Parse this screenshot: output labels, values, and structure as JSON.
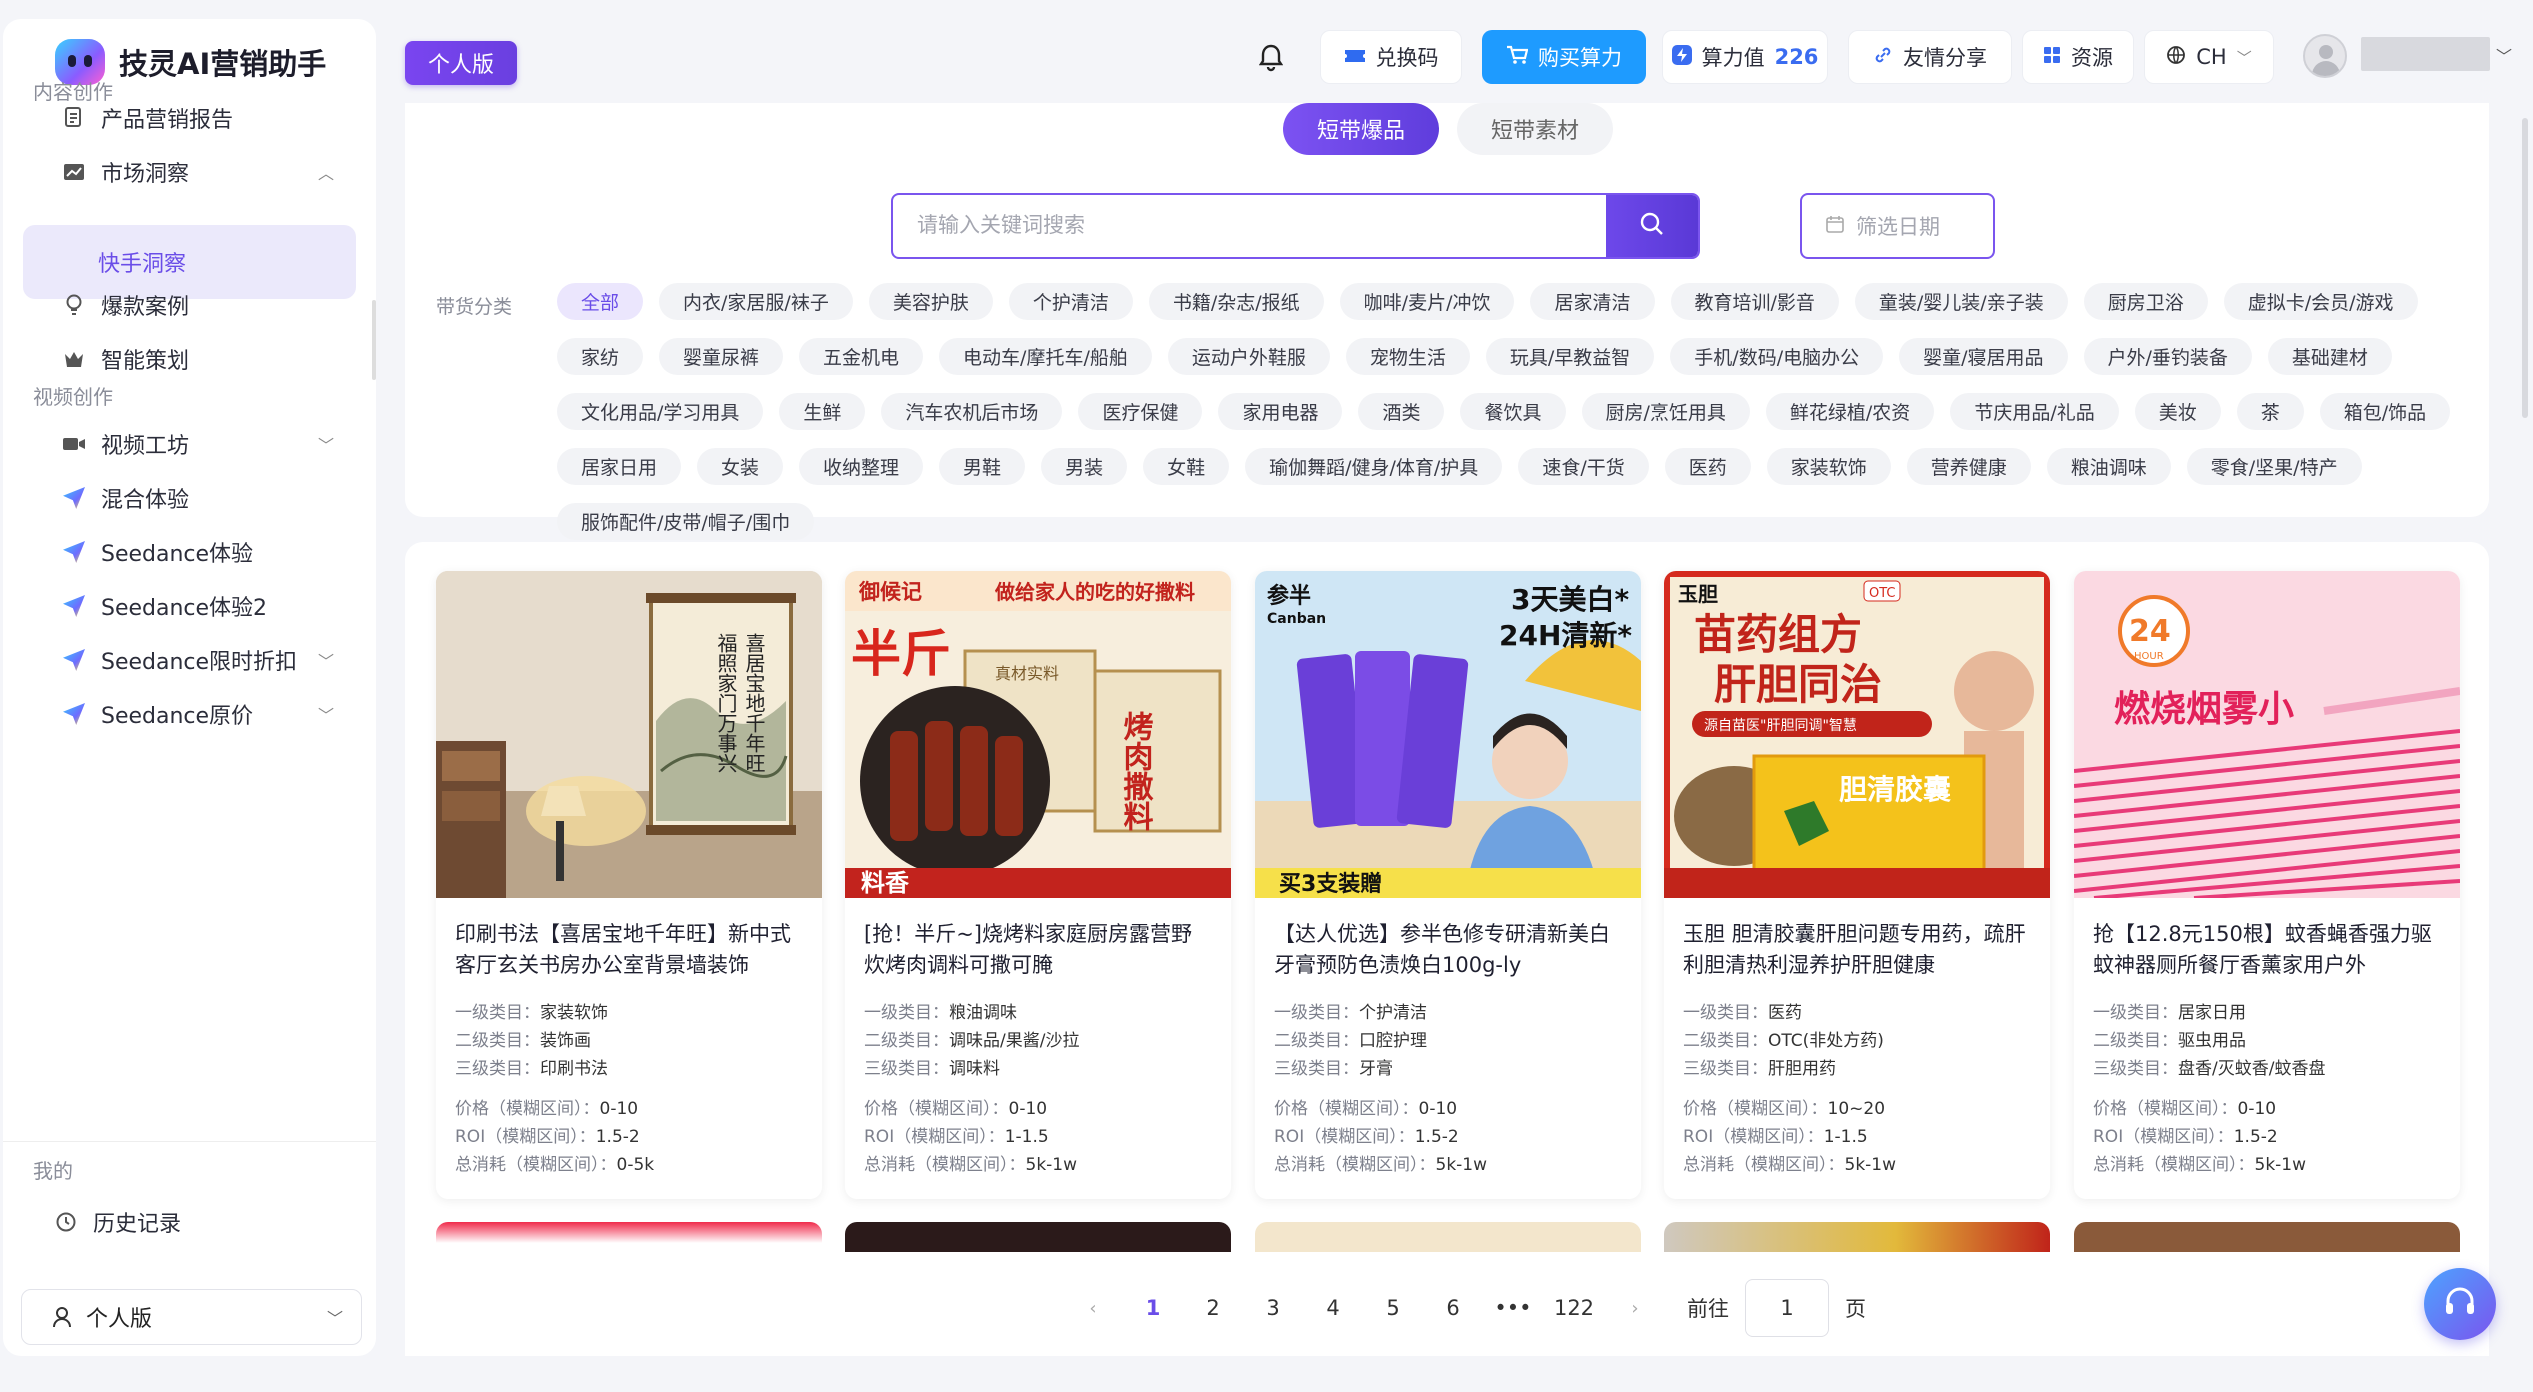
{
  "app": {
    "name": "技灵AI营销助手",
    "edition_badge": "个人版"
  },
  "sidebar": {
    "sections": {
      "content": "内容创作",
      "video": "视频创作",
      "mine": "我的"
    },
    "items": [
      {
        "label": "产品营销报告",
        "icon": "report-icon"
      },
      {
        "label": "市场洞察",
        "icon": "chart-icon"
      },
      {
        "label": "快手洞察",
        "icon": ""
      },
      {
        "label": "爆款案例",
        "icon": "bulb-icon"
      },
      {
        "label": "智能策划",
        "icon": "crown-icon"
      },
      {
        "label": "视频工坊",
        "icon": "video-icon"
      },
      {
        "label": "混合体验",
        "icon": "plane-icon"
      },
      {
        "label": "Seedance体验",
        "icon": "plane-icon"
      },
      {
        "label": "Seedance体验2",
        "icon": "plane-icon"
      },
      {
        "label": "Seedance限时折扣",
        "icon": "plane-icon"
      },
      {
        "label": "Seedance原价",
        "icon": "plane-icon"
      },
      {
        "label": "历史记录",
        "icon": "history-icon"
      }
    ],
    "user_plan": "个人版"
  },
  "topbar": {
    "redeem": "兑换码",
    "buy": "购买算力",
    "credits_label": "算力值",
    "credits_value": "226",
    "share": "友情分享",
    "resources": "资源",
    "language": "CH"
  },
  "main": {
    "tabs": [
      {
        "label": "短带爆品",
        "active": true
      },
      {
        "label": "短带素材",
        "active": false
      }
    ],
    "search_placeholder": "请输入关键词搜索",
    "date_placeholder": "筛选日期",
    "category_label": "带货分类",
    "categories": [
      "全部",
      "内衣/家居服/袜子",
      "美容护肤",
      "个护清洁",
      "书籍/杂志/报纸",
      "咖啡/麦片/冲饮",
      "居家清洁",
      "教育培训/影音",
      "童装/婴儿装/亲子装",
      "厨房卫浴",
      "虚拟卡/会员/游戏",
      "家纺",
      "婴童尿裤",
      "五金机电",
      "电动车/摩托车/船舶",
      "运动户外鞋服",
      "宠物生活",
      "玩具/早教益智",
      "手机/数码/电脑办公",
      "婴童/寝居用品",
      "户外/垂钓装备",
      "基础建材",
      "文化用品/学习用具",
      "生鲜",
      "汽车农机后市场",
      "医疗保健",
      "家用电器",
      "酒类",
      "餐饮具",
      "厨房/烹饪用具",
      "鲜花绿植/农资",
      "节庆用品/礼品",
      "美妆",
      "茶",
      "箱包/饰品",
      "居家日用",
      "女装",
      "收纳整理",
      "男鞋",
      "男装",
      "女鞋",
      "瑜伽舞蹈/健身/体育/护具",
      "速食/干货",
      "医药",
      "家装软饰",
      "营养健康",
      "粮油调味",
      "零食/坚果/特产",
      "服饰配件/皮带/帽子/围巾"
    ]
  },
  "labels": {
    "l1": "一级类目：",
    "l2": "二级类目：",
    "l3": "三级类目：",
    "price": "价格（模糊区间）：",
    "roi": "ROI（模糊区间）：",
    "spend": "总消耗（模糊区间）："
  },
  "products": [
    {
      "title": "印刷书法【喜居宝地千年旺】新中式客厅玄关书房办公室背景墙装饰",
      "cat1": "家装软饰",
      "cat2": "装饰画",
      "cat3": "印刷书法",
      "price": "0-10",
      "roi": "1.5-2",
      "spend": "0-5k",
      "thumb_texts": [
        "喜居宝地千年旺",
        "福照家门万事兴"
      ]
    },
    {
      "title": "[抢！半斤~]烧烤料家庭厨房露营野炊烤肉调料可撒可腌",
      "cat1": "粮油调味",
      "cat2": "调味品/果酱/沙拉",
      "cat3": "调味料",
      "price": "0-10",
      "roi": "1-1.5",
      "spend": "5k-1w",
      "thumb_texts": [
        "御候记",
        "做给家人的吃的好撒料",
        "半斤",
        "真材实料",
        "烤肉撒料",
        "料香"
      ]
    },
    {
      "title": "【达人优选】参半色修专研清新美白牙膏预防色渍焕白100g-ly",
      "cat1": "个护清洁",
      "cat2": "口腔护理",
      "cat3": "牙膏",
      "price": "0-10",
      "roi": "1.5-2",
      "spend": "5k-1w",
      "thumb_texts": [
        "参半",
        "Canban",
        "3天美白*",
        "24H清新*",
        "买3支装贈"
      ]
    },
    {
      "title": "玉胆 胆清胶囊肝胆问题专用药，疏肝利胆清热利湿养护肝胆健康",
      "cat1": "医药",
      "cat2": "OTC(非处方药)",
      "cat3": "肝胆用药",
      "price": "10~20",
      "roi": "1-1.5",
      "spend": "5k-1w",
      "thumb_texts": [
        "玉胆",
        "OTC",
        "苗药组方",
        "肝胆同治",
        "源自苗医\"肝胆同调\"智慧",
        "胆清胶囊"
      ]
    },
    {
      "title": "抢【12.8元150根】蚊香蝇香强力驱蚊神器厕所餐厅香薰家用户外",
      "cat1": "居家日用",
      "cat2": "驱虫用品",
      "cat3": "盘香/灭蚊香/蚊香盘",
      "price": "0-10",
      "roi": "1.5-2",
      "spend": "5k-1w",
      "thumb_texts": [
        "24",
        "HOUR",
        "燃烧烟雾小"
      ]
    }
  ],
  "pagination": {
    "pages": [
      "1",
      "2",
      "3",
      "4",
      "5",
      "6",
      "•••",
      "122"
    ],
    "goto_label": "前往",
    "goto_value": "1",
    "page_suffix": "页"
  },
  "colors": {
    "accent": "#6a4de8",
    "blue": "#1e9bff"
  }
}
